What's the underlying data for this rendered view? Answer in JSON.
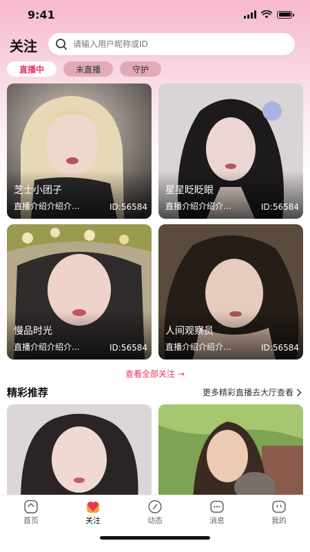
{
  "status_bar": {
    "time": "9:41"
  },
  "header": {
    "title": "关注",
    "search_placeholder": "请输入用户昵称或ID"
  },
  "tabs": [
    {
      "label": "直播中",
      "active": true
    },
    {
      "label": "未直播",
      "active": false
    },
    {
      "label": "守护",
      "active": false
    }
  ],
  "cards": [
    {
      "name": "芝士小团子",
      "intro": "直播介绍介绍介...",
      "id": "ID:56584"
    },
    {
      "name": "星星眨眨眼",
      "intro": "直播介绍介绍介...",
      "id": "ID:56584"
    },
    {
      "name": "慢品时光",
      "intro": "直播介绍介绍介...",
      "id": "ID:56584"
    },
    {
      "name": "人间观察员",
      "intro": "直播介绍介绍介...",
      "id": "ID:56584"
    }
  ],
  "view_all": {
    "label": "查看全部关注",
    "arrow": "→"
  },
  "recommend": {
    "title": "精彩推荐",
    "more": "更多精彩直播去大厅查看"
  },
  "nav": [
    {
      "label": "首页",
      "icon": "home-icon"
    },
    {
      "label": "关注",
      "icon": "heart-icon",
      "active": true
    },
    {
      "label": "动态",
      "icon": "compass-icon"
    },
    {
      "label": "消息",
      "icon": "message-icon"
    },
    {
      "label": "我的",
      "icon": "profile-icon"
    }
  ],
  "colors": {
    "accent": "#e8335f",
    "tab_inactive": "#e2aab9"
  }
}
